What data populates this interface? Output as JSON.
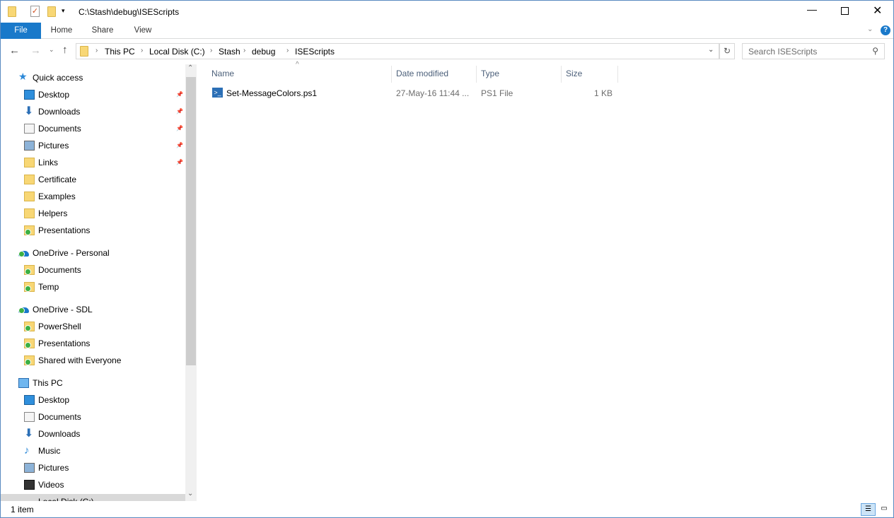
{
  "window": {
    "title": "C:\\Stash\\debug\\ISEScripts"
  },
  "ribbon": {
    "tabs": [
      "File",
      "Home",
      "Share",
      "View"
    ]
  },
  "address": {
    "crumbs": [
      "This PC",
      "Local Disk (C:)",
      "Stash",
      "debug",
      "ISEScripts"
    ]
  },
  "search": {
    "placeholder": "Search ISEScripts"
  },
  "columns": [
    "Name",
    "Date modified",
    "Type",
    "Size"
  ],
  "files": [
    {
      "name": "Set-MessageColors.ps1",
      "date": "27-May-16 11:44 ...",
      "type": "PS1 File",
      "size": "1 KB"
    }
  ],
  "nav": [
    {
      "label": "Quick access",
      "level": 0,
      "icon": "star-icon"
    },
    {
      "label": "Desktop",
      "level": 1,
      "icon": "desktop-icon",
      "pinned": true
    },
    {
      "label": "Downloads",
      "level": 1,
      "icon": "download-icon",
      "pinned": true
    },
    {
      "label": "Documents",
      "level": 1,
      "icon": "document-icon",
      "pinned": true
    },
    {
      "label": "Pictures",
      "level": 1,
      "icon": "pictures-icon",
      "pinned": true
    },
    {
      "label": "Links",
      "level": 1,
      "icon": "folder-icon",
      "pinned": true
    },
    {
      "label": "Certificate",
      "level": 1,
      "icon": "folder-icon"
    },
    {
      "label": "Examples",
      "level": 1,
      "icon": "folder-icon"
    },
    {
      "label": "Helpers",
      "level": 1,
      "icon": "folder-icon"
    },
    {
      "label": "Presentations",
      "level": 1,
      "icon": "synced-folder-icon"
    },
    {
      "label": "OneDrive - Personal",
      "level": 0,
      "icon": "onedrive-icon",
      "gap": true
    },
    {
      "label": "Documents",
      "level": 1,
      "icon": "synced-folder-icon"
    },
    {
      "label": "Temp",
      "level": 1,
      "icon": "synced-folder-icon"
    },
    {
      "label": "OneDrive - SDL",
      "level": 0,
      "icon": "onedrive-icon",
      "gap": true
    },
    {
      "label": "PowerShell",
      "level": 1,
      "icon": "synced-folder-icon"
    },
    {
      "label": "Presentations",
      "level": 1,
      "icon": "synced-folder-icon"
    },
    {
      "label": "Shared with Everyone",
      "level": 1,
      "icon": "synced-folder-icon"
    },
    {
      "label": "This PC",
      "level": 0,
      "icon": "computer-icon",
      "gap": true
    },
    {
      "label": "Desktop",
      "level": 1,
      "icon": "desktop-icon"
    },
    {
      "label": "Documents",
      "level": 1,
      "icon": "document-icon"
    },
    {
      "label": "Downloads",
      "level": 1,
      "icon": "download-icon"
    },
    {
      "label": "Music",
      "level": 1,
      "icon": "music-icon"
    },
    {
      "label": "Pictures",
      "level": 1,
      "icon": "pictures-icon"
    },
    {
      "label": "Videos",
      "level": 1,
      "icon": "video-icon"
    },
    {
      "label": "Local Disk (C:)",
      "level": 1,
      "icon": "drive-icon",
      "selected": true
    }
  ],
  "status": {
    "count": "1 item"
  }
}
